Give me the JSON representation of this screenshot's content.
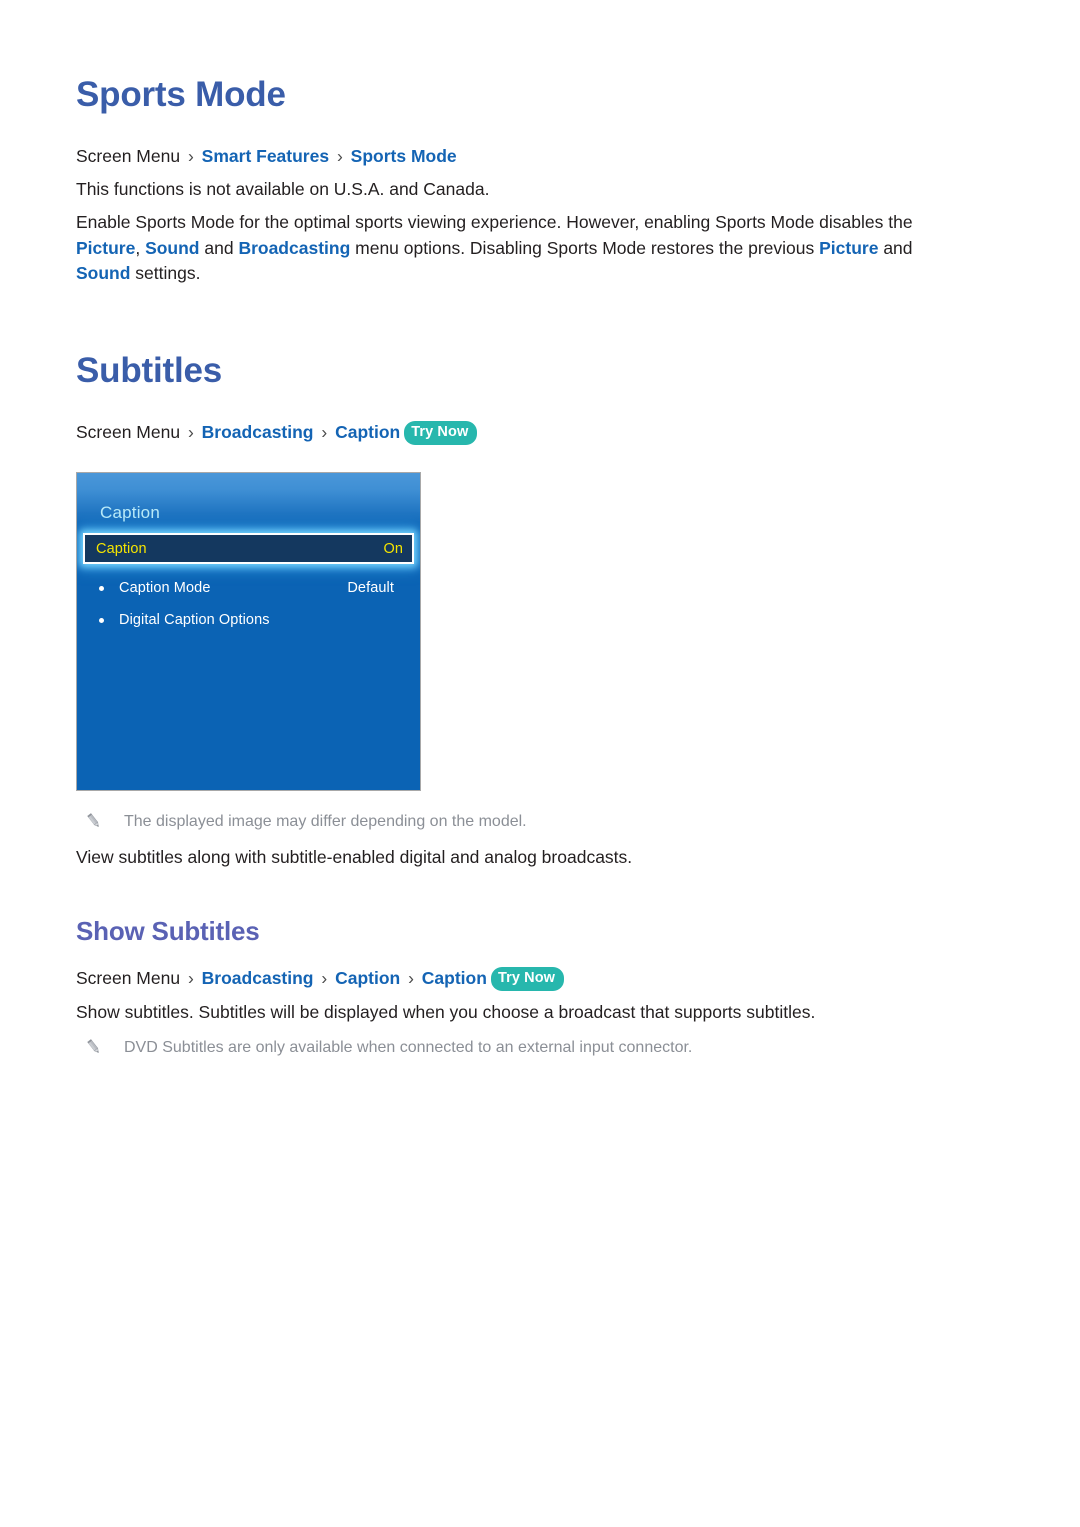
{
  "document": {
    "sections": [
      {
        "id": "sports-mode",
        "title": "Sports Mode",
        "breadcrumb": {
          "root": "Screen Menu",
          "sep": "›",
          "links": [
            "Smart Features",
            "Sports Mode"
          ],
          "try_now": null
        },
        "availability_note": "This functions is not available on U.S.A. and Canada.",
        "paragraph_segments": [
          {
            "text": "Enable Sports Mode for the optimal sports viewing experience. However, enabling Sports Mode disables the ",
            "highlight": false
          },
          {
            "text": "Picture",
            "highlight": true
          },
          {
            "text": ", ",
            "highlight": false
          },
          {
            "text": "Sound",
            "highlight": true
          },
          {
            "text": " and ",
            "highlight": false
          },
          {
            "text": "Broadcasting",
            "highlight": true
          },
          {
            "text": " menu options. Disabling Sports Mode restores the previous ",
            "highlight": false
          },
          {
            "text": "Picture",
            "highlight": true
          },
          {
            "text": " and ",
            "highlight": false
          },
          {
            "text": "Sound",
            "highlight": true
          },
          {
            "text": " settings.",
            "highlight": false
          }
        ]
      },
      {
        "id": "subtitles",
        "title": "Subtitles",
        "breadcrumb": {
          "root": "Screen Menu",
          "sep": "›",
          "links": [
            "Broadcasting",
            "Caption"
          ],
          "try_now": "Try Now"
        },
        "image_note": "The displayed image may differ depending on the model.",
        "description": "View subtitles along with subtitle-enabled digital and analog broadcasts."
      },
      {
        "id": "show-subtitles",
        "title": "Show Subtitles",
        "breadcrumb": {
          "root": "Screen Menu",
          "sep": "›",
          "links": [
            "Broadcasting",
            "Caption",
            "Caption"
          ],
          "try_now": "Try Now"
        },
        "description": "Show subtitles. Subtitles will be displayed when you choose a broadcast that supports subtitles.",
        "note": "DVD Subtitles are only available when connected to an external input connector."
      }
    ]
  },
  "tv_menu": {
    "header_title": "Caption",
    "selected_row": {
      "label": "Caption",
      "value": "On"
    },
    "rows": [
      {
        "label": "Caption Mode",
        "value": "Default"
      },
      {
        "label": "Digital Caption Options",
        "value": ""
      }
    ]
  },
  "colors": {
    "heading": "#3a5da9",
    "subheading": "#5a62b4",
    "link": "#1464b4",
    "try_now_badge": "#27b7ad",
    "note_text": "#8b8f96",
    "tv_panel_body": "#0b63b4",
    "tv_selected_row": "#14385f",
    "tv_selected_text": "#f5e400",
    "tv_header_title": "#b9eaf8"
  },
  "icons": {
    "pencil": "pencil-icon"
  }
}
